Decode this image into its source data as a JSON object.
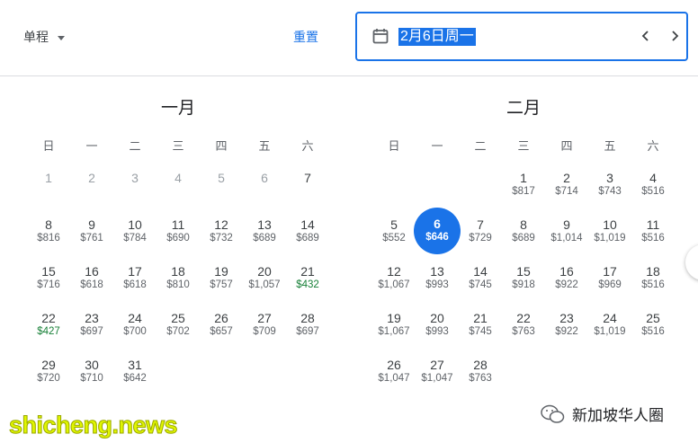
{
  "header": {
    "trip_type": "单程",
    "reset_label": "重置",
    "date_value": "2月6日周一"
  },
  "weekday_labels": [
    "日",
    "一",
    "二",
    "三",
    "四",
    "五",
    "六"
  ],
  "months": [
    {
      "title": "一月",
      "first_weekday": 0,
      "days": [
        {
          "d": "1",
          "p": "",
          "past": true
        },
        {
          "d": "2",
          "p": "",
          "past": true
        },
        {
          "d": "3",
          "p": "",
          "past": true
        },
        {
          "d": "4",
          "p": "",
          "past": true
        },
        {
          "d": "5",
          "p": "",
          "past": true
        },
        {
          "d": "6",
          "p": "",
          "past": true
        },
        {
          "d": "7",
          "p": ""
        },
        {
          "d": "8",
          "p": "$816"
        },
        {
          "d": "9",
          "p": "$761"
        },
        {
          "d": "10",
          "p": "$784"
        },
        {
          "d": "11",
          "p": "$690"
        },
        {
          "d": "12",
          "p": "$732"
        },
        {
          "d": "13",
          "p": "$689"
        },
        {
          "d": "14",
          "p": "$689"
        },
        {
          "d": "15",
          "p": "$716"
        },
        {
          "d": "16",
          "p": "$618"
        },
        {
          "d": "17",
          "p": "$618"
        },
        {
          "d": "18",
          "p": "$810"
        },
        {
          "d": "19",
          "p": "$757"
        },
        {
          "d": "20",
          "p": "$1,057"
        },
        {
          "d": "21",
          "p": "$432",
          "low": true
        },
        {
          "d": "22",
          "p": "$427",
          "low": true
        },
        {
          "d": "23",
          "p": "$697"
        },
        {
          "d": "24",
          "p": "$700"
        },
        {
          "d": "25",
          "p": "$702"
        },
        {
          "d": "26",
          "p": "$657"
        },
        {
          "d": "27",
          "p": "$709"
        },
        {
          "d": "28",
          "p": "$697"
        },
        {
          "d": "29",
          "p": "$720"
        },
        {
          "d": "30",
          "p": "$710"
        },
        {
          "d": "31",
          "p": "$642"
        }
      ]
    },
    {
      "title": "二月",
      "first_weekday": 3,
      "days": [
        {
          "d": "1",
          "p": "$817"
        },
        {
          "d": "2",
          "p": "$714"
        },
        {
          "d": "3",
          "p": "$743"
        },
        {
          "d": "4",
          "p": "$516"
        },
        {
          "d": "5",
          "p": "$552"
        },
        {
          "d": "6",
          "p": "$646",
          "selected": true
        },
        {
          "d": "7",
          "p": "$729"
        },
        {
          "d": "8",
          "p": "$689"
        },
        {
          "d": "9",
          "p": "$1,014"
        },
        {
          "d": "10",
          "p": "$1,019"
        },
        {
          "d": "11",
          "p": "$516"
        },
        {
          "d": "12",
          "p": "$1,067"
        },
        {
          "d": "13",
          "p": "$993"
        },
        {
          "d": "14",
          "p": "$745"
        },
        {
          "d": "15",
          "p": "$918"
        },
        {
          "d": "16",
          "p": "$922"
        },
        {
          "d": "17",
          "p": "$969"
        },
        {
          "d": "18",
          "p": "$516"
        },
        {
          "d": "19",
          "p": "$1,067"
        },
        {
          "d": "20",
          "p": "$993"
        },
        {
          "d": "21",
          "p": "$745"
        },
        {
          "d": "22",
          "p": "$763"
        },
        {
          "d": "23",
          "p": "$922"
        },
        {
          "d": "24",
          "p": "$1,019"
        },
        {
          "d": "25",
          "p": "$516"
        },
        {
          "d": "26",
          "p": "$1,047"
        },
        {
          "d": "27",
          "p": "$1,047"
        },
        {
          "d": "28",
          "p": "$763"
        }
      ]
    }
  ],
  "watermark": {
    "site": "shicheng.news",
    "account": "新加坡华人圈"
  },
  "colors": {
    "accent": "#1a73e8",
    "low_price": "#188038",
    "watermark": "#e0f600"
  },
  "icons": {
    "calendar": "calendar-icon",
    "prev": "chevron-left-icon",
    "next": "chevron-right-icon",
    "dropdown": "caret-down-icon",
    "wechat": "wechat-icon"
  }
}
